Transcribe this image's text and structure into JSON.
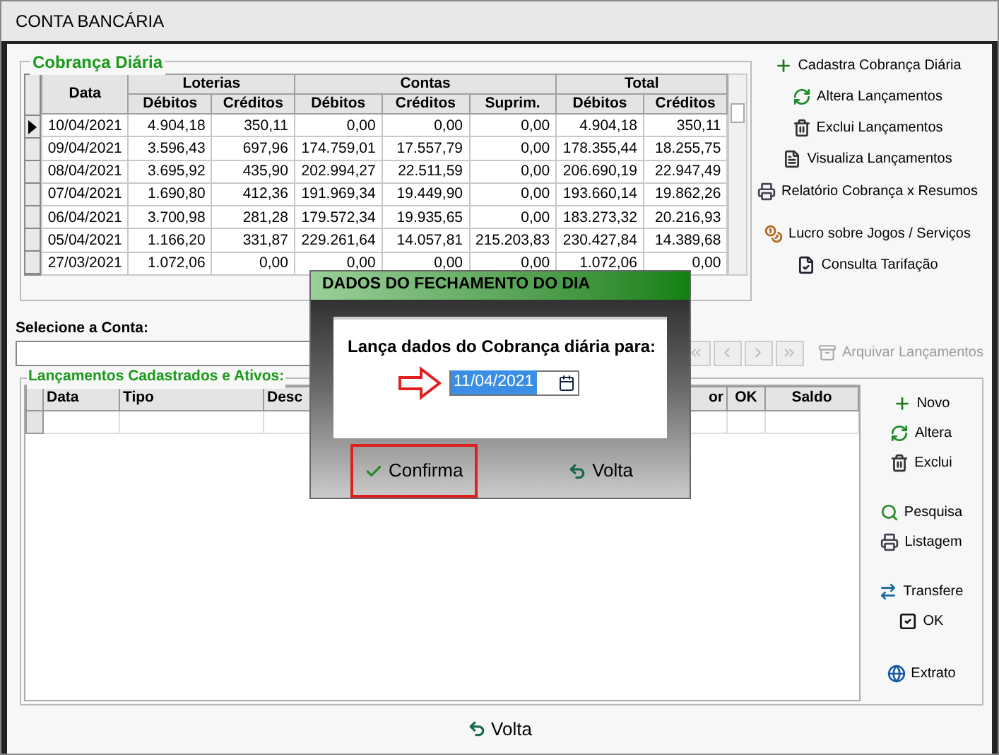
{
  "window": {
    "title": "CONTA BANCÁRIA"
  },
  "cobranca": {
    "title": "Cobrança Diária",
    "group_headers": [
      "Loterias",
      "Contas",
      "Total"
    ],
    "columns": [
      "Data",
      "Débitos",
      "Créditos",
      "Débitos",
      "Créditos",
      "Suprim.",
      "Débitos",
      "Créditos"
    ],
    "rows": [
      {
        "selected": true,
        "cells": [
          "10/04/2021",
          "4.904,18",
          "350,11",
          "0,00",
          "0,00",
          "0,00",
          "4.904,18",
          "350,11"
        ]
      },
      {
        "selected": false,
        "cells": [
          "09/04/2021",
          "3.596,43",
          "697,96",
          "174.759,01",
          "17.557,79",
          "0,00",
          "178.355,44",
          "18.255,75"
        ]
      },
      {
        "selected": false,
        "cells": [
          "08/04/2021",
          "3.695,92",
          "435,90",
          "202.994,27",
          "22.511,59",
          "0,00",
          "206.690,19",
          "22.947,49"
        ]
      },
      {
        "selected": false,
        "cells": [
          "07/04/2021",
          "1.690,80",
          "412,36",
          "191.969,34",
          "19.449,90",
          "0,00",
          "193.660,14",
          "19.862,26"
        ]
      },
      {
        "selected": false,
        "cells": [
          "06/04/2021",
          "3.700,98",
          "281,28",
          "179.572,34",
          "19.935,65",
          "0,00",
          "183.273,32",
          "20.216,93"
        ]
      },
      {
        "selected": false,
        "cells": [
          "05/04/2021",
          "1.166,20",
          "331,87",
          "229.261,64",
          "14.057,81",
          "215.203,83",
          "230.427,84",
          "14.389,68"
        ]
      },
      {
        "selected": false,
        "cells": [
          "27/03/2021",
          "1.072,06",
          "0,00",
          "0,00",
          "0,00",
          "0,00",
          "1.072,06",
          "0,00"
        ]
      }
    ]
  },
  "actions": [
    {
      "kind": "plus",
      "label": "Cadastra Cobrança Diária"
    },
    {
      "kind": "refresh",
      "label": "Altera Lançamentos"
    },
    {
      "kind": "trash",
      "label": "Exclui Lançamentos"
    },
    {
      "kind": "document",
      "label": "Visualiza Lançamentos"
    },
    {
      "kind": "printer",
      "label": "Relatório Cobrança x Resumos"
    },
    {
      "kind": "coins",
      "label": "Lucro sobre Jogos / Serviços"
    },
    {
      "kind": "check",
      "label": "Consulta Tarifação"
    }
  ],
  "account": {
    "label": "Selecione a Conta:",
    "archive_button": {
      "label": "Arquivar Lançamentos",
      "disabled": true
    }
  },
  "lancamentos": {
    "title": "Lançamentos Cadastrados e Ativos:",
    "columns": [
      "Data",
      "Tipo",
      "Desc",
      "or",
      "OK",
      "Saldo"
    ]
  },
  "lancamento_actions": [
    {
      "kind": "plus",
      "label": "Novo"
    },
    {
      "kind": "refresh",
      "label": "Altera"
    },
    {
      "kind": "trash",
      "label": "Exclui"
    },
    {
      "kind": "search",
      "label": "Pesquisa"
    },
    {
      "kind": "printer",
      "label": "Listagem"
    },
    {
      "kind": "transfer",
      "label": "Transfere"
    },
    {
      "kind": "checkbox",
      "label": "OK"
    },
    {
      "kind": "globe",
      "label": "Extrato"
    }
  ],
  "dialog": {
    "title": "DADOS DO FECHAMENTO DO DIA",
    "prompt": "Lança dados do Cobrança diária para:",
    "date": {
      "value": "11/04/2021",
      "text_selected": true
    },
    "buttons": [
      {
        "kind": "confirm",
        "label": "Confirma",
        "highlighted": true
      },
      {
        "kind": "back",
        "label": "Volta",
        "highlighted": false
      }
    ]
  },
  "footer": {
    "back_button": "Volta"
  }
}
